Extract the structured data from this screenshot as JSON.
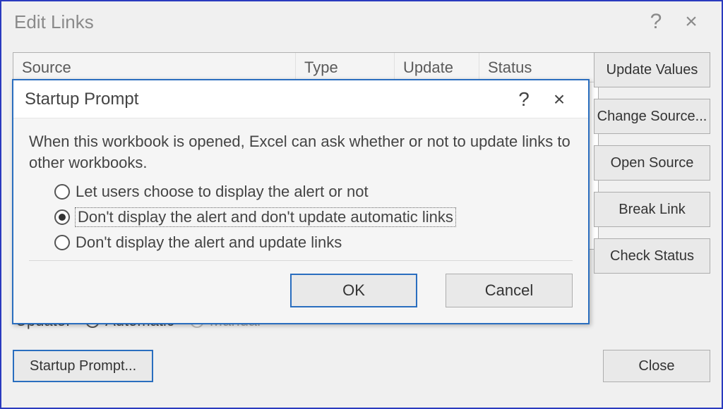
{
  "editLinks": {
    "title": "Edit Links",
    "helpGlyph": "?",
    "closeGlyph": "×",
    "columns": {
      "source": "Source",
      "type": "Type",
      "update": "Update",
      "status": "Status"
    },
    "buttons": {
      "updateValues": "Update Values",
      "changeSource": "Change Source...",
      "openSource": "Open Source",
      "breakLink": "Break Link",
      "checkStatus": "Check Status"
    },
    "updateLabel": "Update:",
    "updateRadios": {
      "automatic": "Automatic",
      "manual": "Manual",
      "selected": "automatic"
    },
    "startupPromptBtn": "Startup Prompt...",
    "closeBtn": "Close"
  },
  "prompt": {
    "title": "Startup Prompt",
    "helpGlyph": "?",
    "closeGlyph": "×",
    "message": "When this workbook is opened, Excel can ask whether or not to update links to other workbooks.",
    "options": [
      {
        "label": "Let users choose to display the alert or not",
        "selected": false
      },
      {
        "label": "Don't display the alert and don't update automatic links",
        "selected": true
      },
      {
        "label": "Don't display the alert and update links",
        "selected": false
      }
    ],
    "ok": "OK",
    "cancel": "Cancel"
  }
}
